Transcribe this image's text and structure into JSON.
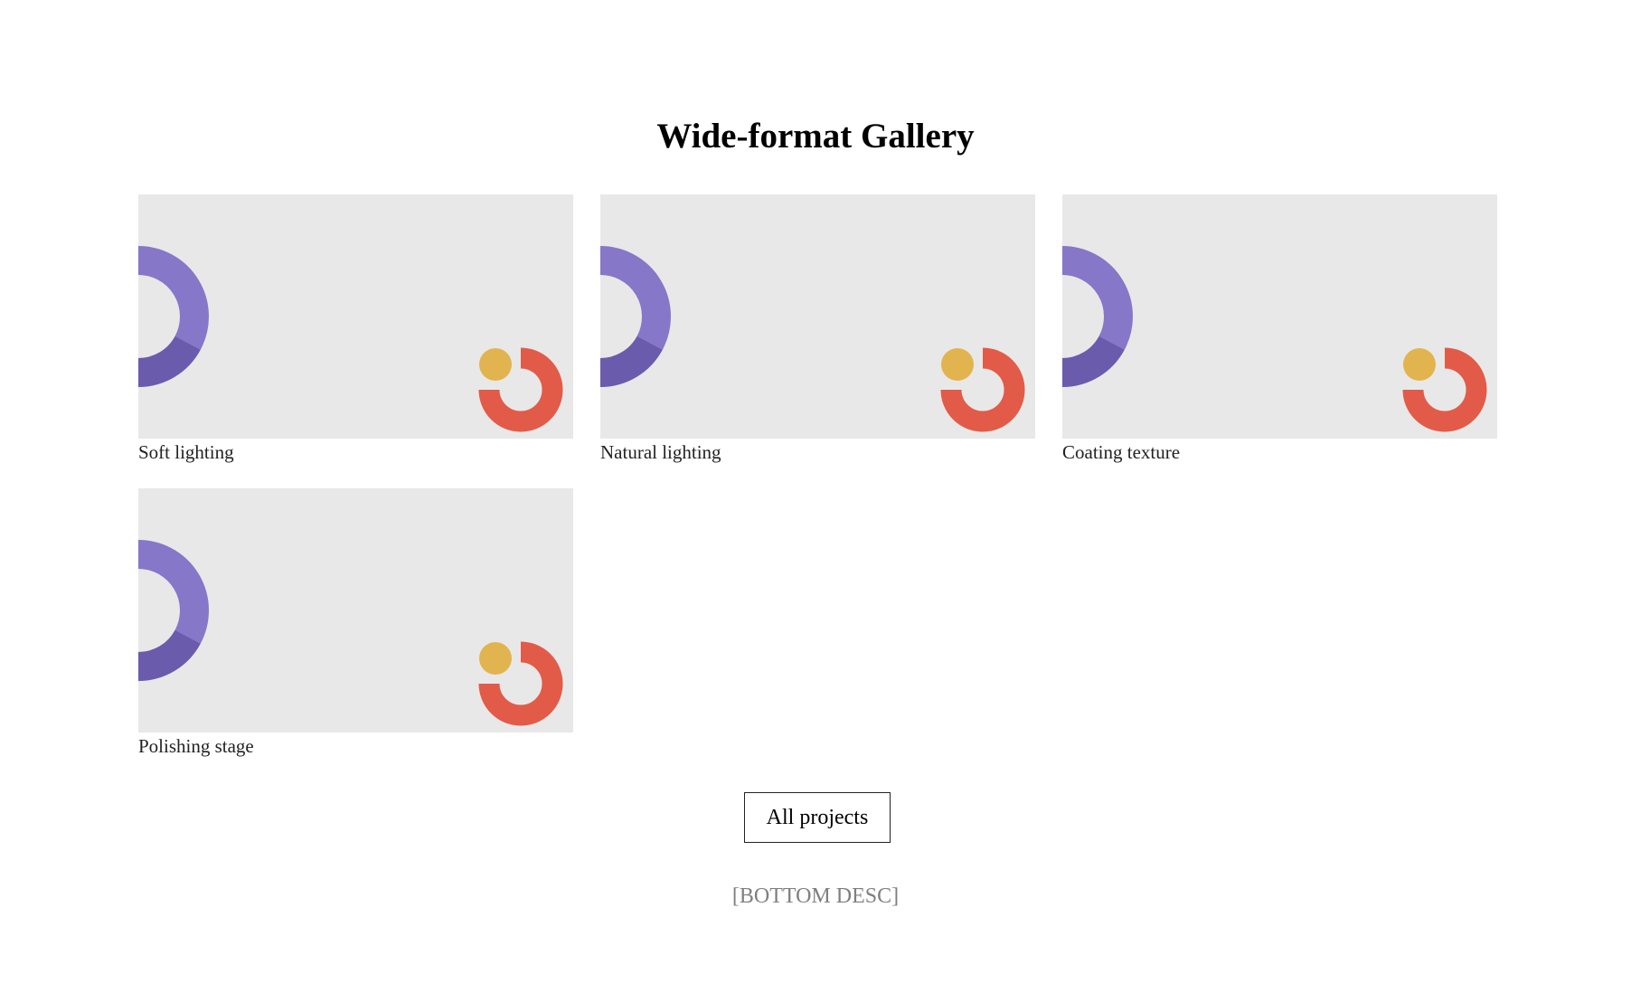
{
  "page": {
    "title": "Wide-format Gallery",
    "button_label": "All projects",
    "bottom_desc": "[BOTTOM DESC]"
  },
  "gallery": {
    "items": [
      {
        "caption": "Soft lighting"
      },
      {
        "caption": "Natural lighting"
      },
      {
        "caption": "Coating texture"
      },
      {
        "caption": "Polishing stage"
      }
    ]
  },
  "colors": {
    "thumbnail_bg": "#e9e8e8",
    "ring_purple_light": "#8677c9",
    "ring_purple_dark": "#6b5bad",
    "ring_red": "#e25b48",
    "dot_yellow": "#e2b44f"
  }
}
